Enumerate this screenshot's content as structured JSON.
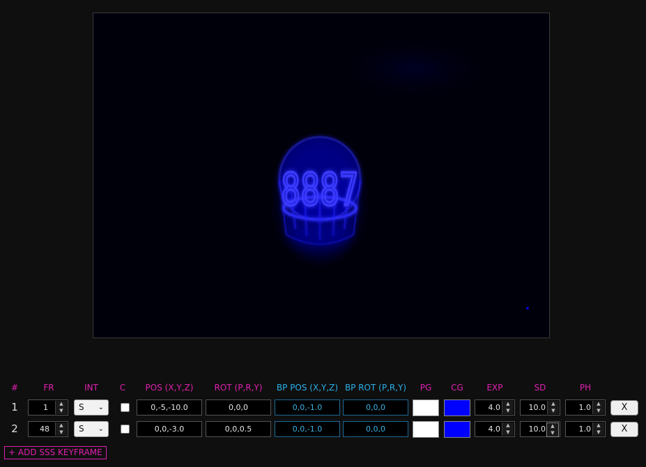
{
  "colors": {
    "magenta": "#e020b0",
    "cyan": "#2ab0e8",
    "bp_border": "#1e6a95",
    "glow_blue": "#0000ff"
  },
  "viewport": {
    "object_text": "8887"
  },
  "headers": {
    "index": "#",
    "fr": "FR",
    "int": "INT",
    "c": "C",
    "pos": "POS (X,Y,Z)",
    "rot": "ROT (P,R,Y)",
    "bp_pos": "BP POS (X,Y,Z)",
    "bp_rot": "BP ROT (P,R,Y)",
    "pg": "PG",
    "cg": "CG",
    "exp": "EXP",
    "sd": "SD",
    "ph": "PH"
  },
  "keyframes": [
    {
      "index": "1",
      "fr": "1",
      "int": "S",
      "c_checked": false,
      "pos": "0,-5,-10.0",
      "rot": "0,0,0",
      "bp_pos": "0,0,-1.0",
      "bp_rot": "0,0,0",
      "pg_color": "#ffffff",
      "cg_color": "#0000ff",
      "exp": "4.0",
      "sd": "10.0",
      "ph": "1.0",
      "delete_label": "X"
    },
    {
      "index": "2",
      "fr": "48",
      "int": "S",
      "c_checked": false,
      "pos": "0,0,-3.0",
      "rot": "0,0,0.5",
      "bp_pos": "0,0,-1.0",
      "bp_rot": "0,0,0",
      "pg_color": "#ffffff",
      "cg_color": "#0000ff",
      "exp": "4.0",
      "sd": "10.0",
      "ph": "1.0",
      "delete_label": "X"
    }
  ],
  "add_button_label": "+ ADD SSS KEYFRAME"
}
